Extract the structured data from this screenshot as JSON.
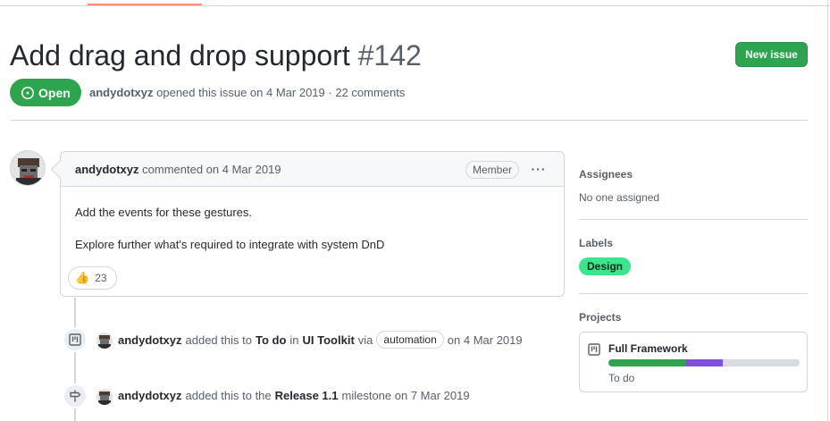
{
  "issue": {
    "title": "Add drag and drop support",
    "number": "#142",
    "state": "Open",
    "author": "andydotxyz",
    "opened_text": "opened this issue on 4 Mar 2019 · 22 comments"
  },
  "header": {
    "new_issue_label": "New issue"
  },
  "comment": {
    "author": "andydotxyz",
    "action": "commented on 4 Mar 2019",
    "role_badge": "Member",
    "more_label": "···",
    "body": [
      "Add the events for these gestures.",
      "Explore further what's required to integrate with system DnD"
    ],
    "reaction": {
      "icon": "thumbs-up",
      "emoji": "👍",
      "count": "23"
    }
  },
  "timeline": [
    {
      "icon": "project-icon",
      "actor": "andydotxyz",
      "pre": "added this to",
      "column": "To do",
      "mid": "in",
      "project": "UI Toolkit",
      "via": "via",
      "bot": "automation",
      "date": "on 4 Mar 2019"
    },
    {
      "icon": "milestone-icon",
      "actor": "andydotxyz",
      "pre": "added this to the",
      "milestone": "Release 1.1",
      "post": "milestone on 7 Mar 2019"
    }
  ],
  "sidebar": {
    "assignees": {
      "title": "Assignees",
      "value": "No one assigned"
    },
    "labels": {
      "title": "Labels",
      "items": [
        {
          "name": "Design",
          "color": "#3ae58e"
        }
      ]
    },
    "projects": {
      "title": "Projects",
      "items": [
        {
          "name": "Full Framework",
          "column": "To do",
          "progress": {
            "done": 0.4,
            "in_progress": 0.2,
            "todo": 0.4
          },
          "colors": {
            "done": "#2da44e",
            "in_progress": "#8250df",
            "todo": "#d8dbe2"
          }
        }
      ]
    }
  },
  "colors": {
    "open": "#2da44e",
    "primary_button": "#2da44e",
    "tab_underline": "#fd8c73"
  }
}
